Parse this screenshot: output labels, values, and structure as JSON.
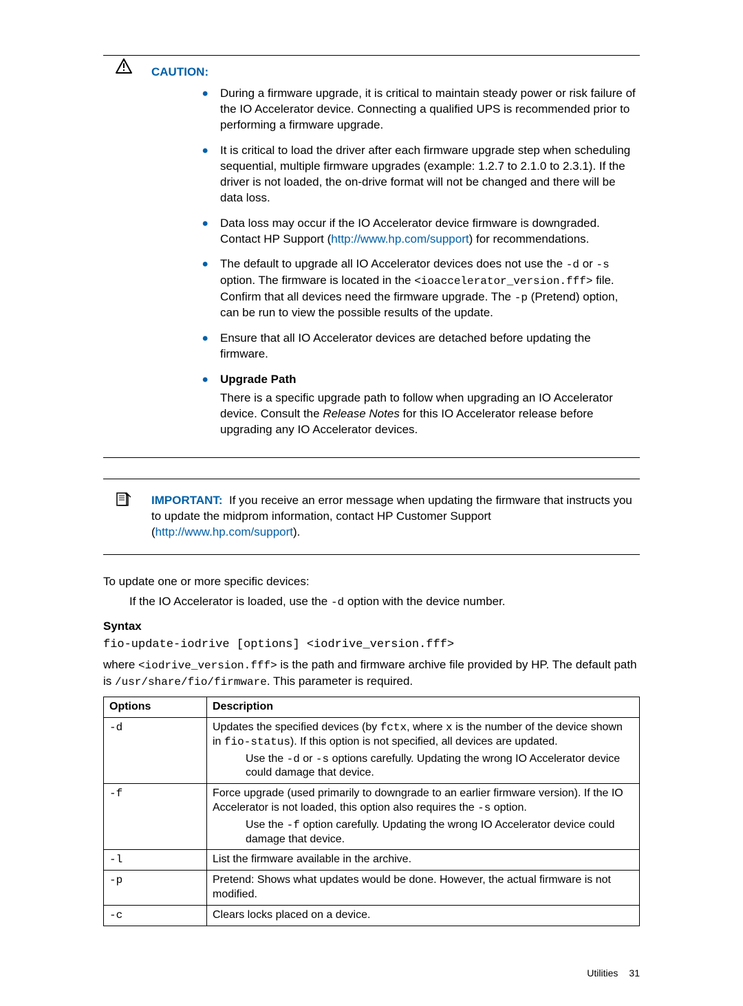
{
  "caution": {
    "label": "CAUTION:",
    "items": {
      "i0": "During a firmware upgrade, it is critical to maintain steady power or risk failure of the IO Accelerator device. Connecting a qualified UPS is recommended prior to performing a firmware upgrade.",
      "i1": "It is critical to load the driver after each firmware upgrade step when scheduling sequential, multiple firmware upgrades (example: 1.2.7 to 2.1.0 to 2.3.1). If the driver is not loaded, the on-drive format will not be changed and there will be data loss.",
      "i2_pre": "Data loss may occur if the IO Accelerator device firmware is downgraded. Contact HP Support (",
      "i2_link": "http://www.hp.com/support",
      "i2_post": ") for recommendations.",
      "i3_a": "The default to upgrade all IO Accelerator devices does not use the ",
      "i3_code1": "-d",
      "i3_b": " or ",
      "i3_code2": "-s",
      "i3_c": " option. The firmware is located in the ",
      "i3_code3": "<ioaccelerator_version.fff>",
      "i3_d": " file. Confirm that all devices need the firmware upgrade. The ",
      "i3_code4": "-p",
      "i3_e": " (Pretend) option, can be run to view the possible results of the update.",
      "i4": "Ensure that all IO Accelerator devices are detached before updating the firmware.",
      "i5_head": "Upgrade Path",
      "i5_body_a": "There is a specific upgrade path to follow when upgrading an IO Accelerator device. Consult the ",
      "i5_body_em": "Release Notes",
      "i5_body_b": " for this IO Accelerator release before upgrading any IO Accelerator devices."
    }
  },
  "important": {
    "label": "IMPORTANT:",
    "text_a": "If you receive an error message when updating the firmware that instructs you to update the midprom information, contact HP Customer Support (",
    "link": "http://www.hp.com/support",
    "text_b": ")."
  },
  "body": {
    "p1": "To update one or more specific devices:",
    "p2_a": "If the IO Accelerator is loaded, use the ",
    "p2_code": "-d",
    "p2_b": " option with the device number.",
    "syntax_head": "Syntax",
    "syntax_cmd": "fio-update-iodrive [options] <iodrive_version.fff>",
    "where_a": "where ",
    "where_code1": "<iodrive_version.fff>",
    "where_b": " is the path and firmware archive file provided by HP. The default path is ",
    "where_code2": "/usr/share/fio/firmware",
    "where_c": ". This parameter is required."
  },
  "table": {
    "h1": "Options",
    "h2": "Description",
    "r0": {
      "opt": "-d",
      "desc_a": "Updates the specified devices (by ",
      "desc_code1": "fctx",
      "desc_b": ", where ",
      "desc_code2": "x",
      "desc_c": " is the number of the device shown in ",
      "desc_code3": "fio-status",
      "desc_d": "). If this option is not specified, all devices are updated.",
      "note_a": "Use the ",
      "note_code1": "-d",
      "note_b": " or ",
      "note_code2": "-s",
      "note_c": " options carefully. Updating the wrong IO Accelerator device could damage that device."
    },
    "r1": {
      "opt": "-f",
      "desc_a": "Force upgrade (used primarily to downgrade to an earlier firmware version). If the IO Accelerator is not loaded, this option also requires the ",
      "desc_code1": "-s",
      "desc_b": " option.",
      "note_a": "Use the ",
      "note_code1": "-f",
      "note_b": " option carefully. Updating the wrong IO Accelerator device could damage that device."
    },
    "r2": {
      "opt": "-l",
      "desc": "List the firmware available in the archive."
    },
    "r3": {
      "opt": "-p",
      "desc": "Pretend: Shows what updates would be done. However, the actual firmware is not modified."
    },
    "r4": {
      "opt": "-c",
      "desc": "Clears locks placed on a device."
    }
  },
  "footer": {
    "section": "Utilities",
    "page": "31"
  }
}
